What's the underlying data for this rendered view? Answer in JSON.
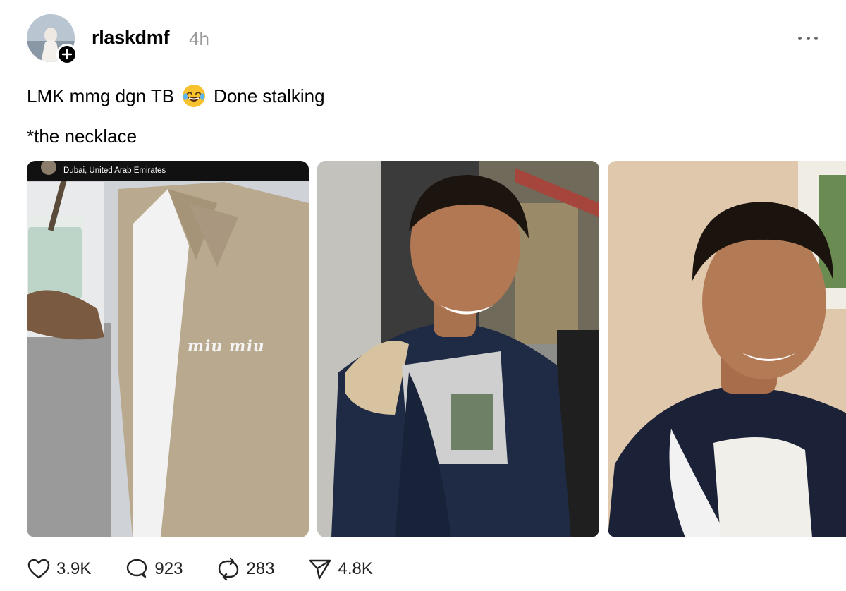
{
  "post": {
    "username": "rlaskdmf",
    "timestamp": "4h",
    "text_line1_before": "LMK mmg dgn TB",
    "emoji": "joy-emoji",
    "text_line1_after": "Done stalking",
    "text_line2": "*the necklace"
  },
  "media": [
    {
      "location_label": "Dubai, United Arab Emirates",
      "brand_text": "miu miu"
    },
    {},
    {}
  ],
  "actions": {
    "likes": "3.9K",
    "replies": "923",
    "reposts": "283",
    "shares": "4.8K"
  },
  "icons": [
    "plus-icon",
    "more-icon",
    "heart-icon",
    "comment-icon",
    "repost-icon",
    "send-icon"
  ]
}
